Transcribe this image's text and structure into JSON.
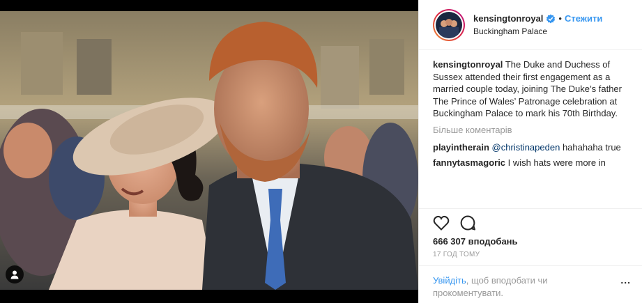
{
  "header": {
    "username": "kensingtonroyal",
    "follow_label": "Стежити",
    "separator": "•",
    "location": "Buckingham Palace"
  },
  "caption": {
    "username": "kensingtonroyal",
    "text": "The Duke and Duchess of Sussex attended their first engagement as a married couple today, joining The Duke’s father The Prince of Wales’ Patronage celebration at Buckingham Palace to mark his 70th Birthday."
  },
  "load_more_label": "Більше коментарів",
  "comments": [
    {
      "username": "playintherain",
      "mention": "@christinapeden",
      "text": "hahahaha true"
    },
    {
      "username": "fannytasmagoric",
      "mention": "",
      "text": "I wish hats were more in"
    }
  ],
  "likes": "666 307 вподобань",
  "timestamp": "17 год тому",
  "login_prompt": {
    "link": "Увійдіть",
    "text": ", щоб вподобати чи прокоментувати."
  },
  "more_options": "...",
  "icons": [
    "heart-icon",
    "comment-icon",
    "tagged-user-icon",
    "verified-badge-icon"
  ],
  "colors": {
    "link": "#3897f0",
    "muted": "#999999",
    "text": "#262626"
  }
}
